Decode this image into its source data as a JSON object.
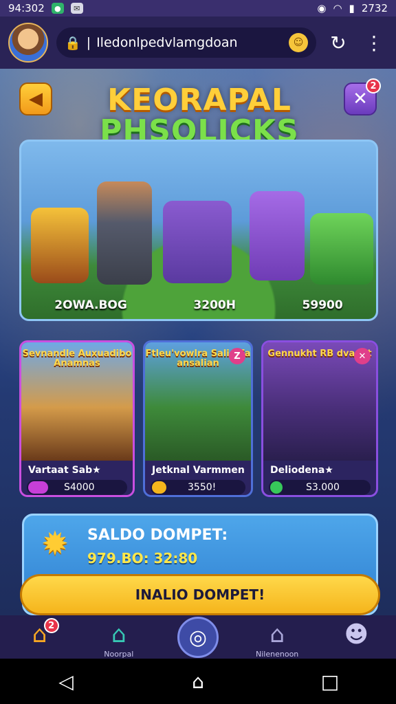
{
  "status_bar": {
    "time": "94:302",
    "clock_right": "2732"
  },
  "browser": {
    "url": "Iledonlpedvlamgdoan"
  },
  "game": {
    "title_line1": "KEORAPAL",
    "title_line2": "PHSOLICKS",
    "close_badge": "2"
  },
  "banner": {
    "prices": [
      "2OWA.BOG",
      "3200H",
      "59900"
    ]
  },
  "cards": [
    {
      "title": "Sevnandle Auxuadibo Anamnas",
      "label": "Vartaat Sab★",
      "value": "S4000",
      "bar_color": "#c73fd8",
      "bar_fill": 0.2,
      "has_close": false
    },
    {
      "title": "Ftleu'vowlra Salid Fa ansalian",
      "label": "Jetknal Varmmen",
      "value": "3550!",
      "bar_color": "#f5b51c",
      "bar_fill": 0.15,
      "has_close": true
    },
    {
      "title": "Gennukht RB dvanet",
      "label": "Deliodena★",
      "value": "S3.000",
      "bar_color": "#37c85a",
      "bar_fill": 0.12,
      "has_close": true
    }
  ],
  "wallet": {
    "title": "SALDO DOMPET:",
    "balance": "979.BO: 32:80",
    "button_label": "INALIO DOMPET!"
  },
  "bottom_nav": {
    "home_badge": "2",
    "items": [
      {
        "icon": "home-icon",
        "label": ""
      },
      {
        "icon": "house-icon",
        "label": "Noorpal"
      },
      {
        "icon": "game-icon",
        "label": ""
      },
      {
        "icon": "shop-icon",
        "label": "Nilenenoon"
      },
      {
        "icon": "chat-icon",
        "label": ""
      }
    ]
  }
}
